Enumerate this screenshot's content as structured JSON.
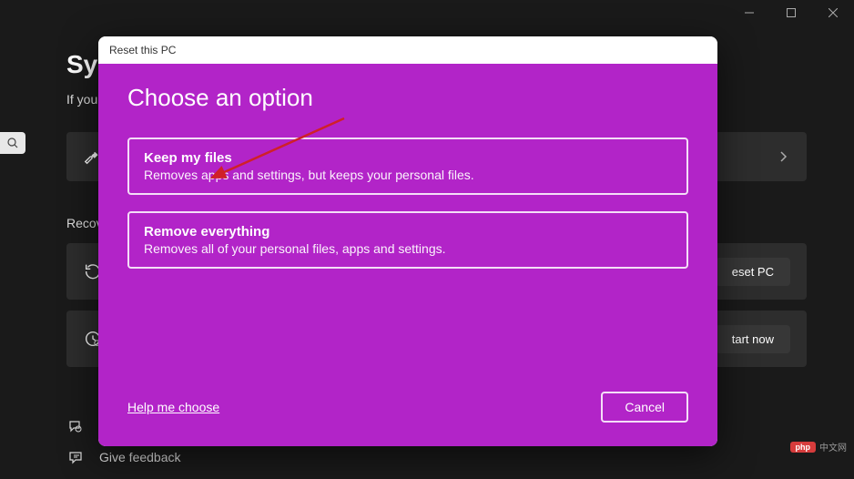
{
  "window": {
    "minimize_icon": "minimize",
    "maximize_icon": "maximize",
    "close_icon": "close"
  },
  "background": {
    "title_partial": "Sy",
    "subtitle_partial": "If you'",
    "section_label": "Recove",
    "reset_button": "eset PC",
    "start_button": "tart now",
    "feedback_g": "G",
    "feedback_label": "Give feedback"
  },
  "dialog": {
    "titlebar": "Reset this PC",
    "heading": "Choose an option",
    "options": [
      {
        "title": "Keep my files",
        "description": "Removes apps and settings, but keeps your personal files."
      },
      {
        "title": "Remove everything",
        "description": "Removes all of your personal files, apps and settings."
      }
    ],
    "help_link": "Help me choose",
    "cancel_label": "Cancel"
  },
  "watermark": {
    "logo": "php",
    "text": "中文网"
  },
  "annotation": {
    "arrow_color": "#d02028"
  }
}
